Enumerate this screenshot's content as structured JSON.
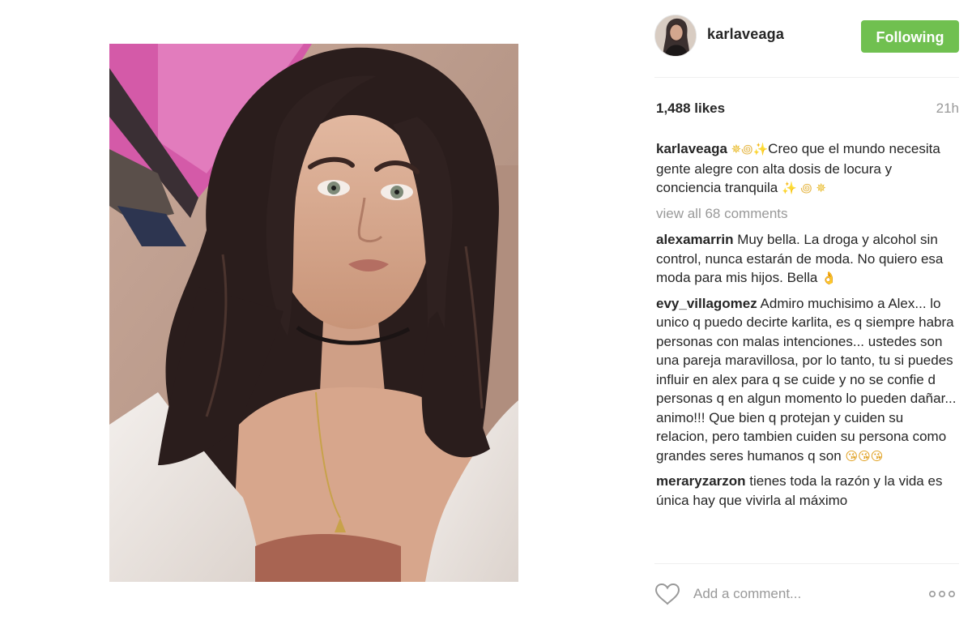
{
  "post": {
    "username": "karlaveaga",
    "follow_button": "Following",
    "likes": "1,488 likes",
    "time": "21h",
    "caption": {
      "user": "karlaveaga",
      "text_emoji_1": "✵",
      "text_emoji_2": "꩜",
      "text_emoji_3": "✨",
      "text": "Creo que el mundo necesita gente alegre con alta dosis de locura y conciencia tranquila",
      "end_emoji_1": "✨",
      "end_emoji_2": "꩜",
      "end_emoji_3": "✵"
    },
    "view_all_comments": "view all 68 comments",
    "comments": [
      {
        "user": "alexamarrin",
        "text": "Muy bella. La droga y alcohol sin control, nunca estarán de moda. No quiero esa moda para mis hijos. Bella",
        "emoji": "👌"
      },
      {
        "user": "evy_villagomez",
        "text": "Admiro muchisimo a Alex... lo unico q puedo decirte karlita, es q siempre habra personas con malas intenciones... ustedes son una pareja maravillosa, por lo tanto, tu si puedes influir en alex para q se cuide y no se confie d personas q en algun momento lo pueden dañar... animo!!! Que bien q protejan y cuiden su relacion, pero tambien cuiden su persona como grandes seres humanos q son",
        "emoji": "😘😘😘"
      },
      {
        "user": "meraryzarzon",
        "text": "tienes toda la razón y la vida es única hay que vivirla al máximo",
        "emoji": ""
      }
    ],
    "add_comment_placeholder": "Add a comment..."
  },
  "icons": {
    "heart": "heart-outline-icon",
    "more": "more-options-icon"
  },
  "colors": {
    "follow_green": "#70c050",
    "muted_text": "#999999",
    "text": "#262626"
  }
}
